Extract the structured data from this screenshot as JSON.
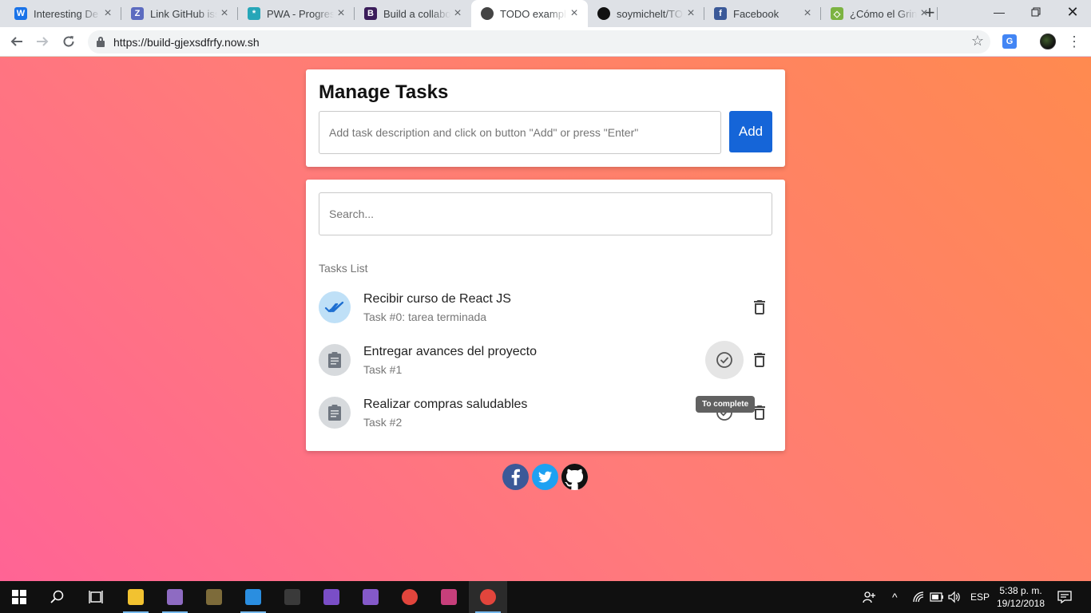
{
  "browser": {
    "tabs": [
      {
        "title": "Interesting De",
        "favicon": "w-icon",
        "color": "#1a73e8",
        "glyph": "W"
      },
      {
        "title": "Link GitHub iss",
        "favicon": "z-icon",
        "color": "#5c6bc0",
        "glyph": "Z"
      },
      {
        "title": "PWA - Progres",
        "favicon": "atom-icon",
        "color": "#26a6b8",
        "glyph": "*"
      },
      {
        "title": "Build a collabo",
        "favicon": "book-icon",
        "color": "#3b1d5a",
        "glyph": "B"
      },
      {
        "title": "TODO example",
        "favicon": "avatar-icon",
        "color": "#444444",
        "glyph": "",
        "active": true
      },
      {
        "title": "soymichelt/TO",
        "favicon": "github-icon",
        "color": "#111111",
        "glyph": ""
      },
      {
        "title": "Facebook",
        "favicon": "facebook-icon",
        "color": "#3b5998",
        "glyph": "f"
      },
      {
        "title": "¿Cómo el Grin",
        "favicon": "diamond-icon",
        "color": "#7cb342",
        "glyph": "◇"
      }
    ],
    "url": "https://build-gjexsdfrfy.now.sh"
  },
  "app": {
    "heading": "Manage Tasks",
    "task_placeholder": "Add task description and click on button \"Add\" or press \"Enter\"",
    "add_label": "Add",
    "search_placeholder": "Search...",
    "list_heading": "Tasks List",
    "tasks": [
      {
        "title": "Recibir curso de React JS",
        "subtitle": "Task #0: tarea terminada",
        "done": true
      },
      {
        "title": "Entregar avances del proyecto",
        "subtitle": "Task #1",
        "done": false
      },
      {
        "title": "Realizar compras saludables",
        "subtitle": "Task #2",
        "done": false
      }
    ],
    "tooltip": "To complete"
  },
  "taskbar": {
    "language": "ESP",
    "time": "5:38 p. m.",
    "date": "19/12/2018",
    "apps": [
      {
        "name": "file-explorer-icon",
        "color": "#f2c230"
      },
      {
        "name": "hyper-icon",
        "color": "#8e6bc2"
      },
      {
        "name": "git-icon",
        "color": "#7d6b3a"
      },
      {
        "name": "vscode-icon",
        "color": "#2a8ee0"
      },
      {
        "name": "terminal-icon",
        "color": "#3a3a3a"
      },
      {
        "name": "visual-studio-icon",
        "color": "#7a4ec7"
      },
      {
        "name": "visual-studio-alt-icon",
        "color": "#8459c9"
      },
      {
        "name": "chrome-icon",
        "color": "#e2453c"
      },
      {
        "name": "markdown-editor-icon",
        "color": "#c73f7b"
      },
      {
        "name": "chrome-active-icon",
        "color": "#e2453c"
      }
    ]
  }
}
